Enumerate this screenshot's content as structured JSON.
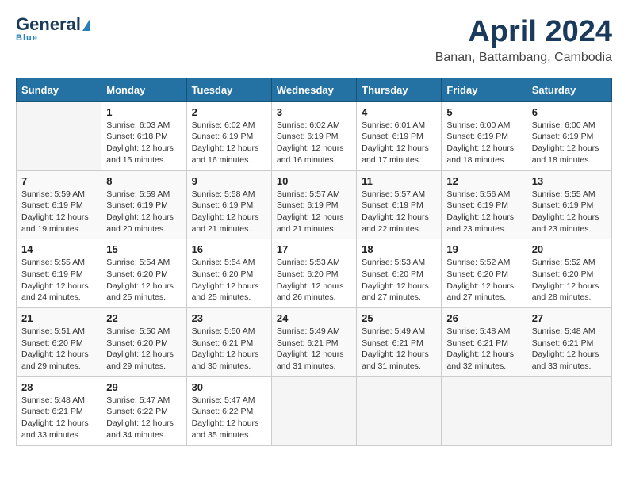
{
  "logo": {
    "general": "General",
    "blue": "Blue",
    "tagline": "Blue"
  },
  "header": {
    "month": "April 2024",
    "location": "Banan, Battambang, Cambodia"
  },
  "weekdays": [
    "Sunday",
    "Monday",
    "Tuesday",
    "Wednesday",
    "Thursday",
    "Friday",
    "Saturday"
  ],
  "weeks": [
    [
      {
        "day": "",
        "sunrise": "",
        "sunset": "",
        "daylight": ""
      },
      {
        "day": "1",
        "sunrise": "Sunrise: 6:03 AM",
        "sunset": "Sunset: 6:18 PM",
        "daylight": "Daylight: 12 hours and 15 minutes."
      },
      {
        "day": "2",
        "sunrise": "Sunrise: 6:02 AM",
        "sunset": "Sunset: 6:19 PM",
        "daylight": "Daylight: 12 hours and 16 minutes."
      },
      {
        "day": "3",
        "sunrise": "Sunrise: 6:02 AM",
        "sunset": "Sunset: 6:19 PM",
        "daylight": "Daylight: 12 hours and 16 minutes."
      },
      {
        "day": "4",
        "sunrise": "Sunrise: 6:01 AM",
        "sunset": "Sunset: 6:19 PM",
        "daylight": "Daylight: 12 hours and 17 minutes."
      },
      {
        "day": "5",
        "sunrise": "Sunrise: 6:00 AM",
        "sunset": "Sunset: 6:19 PM",
        "daylight": "Daylight: 12 hours and 18 minutes."
      },
      {
        "day": "6",
        "sunrise": "Sunrise: 6:00 AM",
        "sunset": "Sunset: 6:19 PM",
        "daylight": "Daylight: 12 hours and 18 minutes."
      }
    ],
    [
      {
        "day": "7",
        "sunrise": "Sunrise: 5:59 AM",
        "sunset": "Sunset: 6:19 PM",
        "daylight": "Daylight: 12 hours and 19 minutes."
      },
      {
        "day": "8",
        "sunrise": "Sunrise: 5:59 AM",
        "sunset": "Sunset: 6:19 PM",
        "daylight": "Daylight: 12 hours and 20 minutes."
      },
      {
        "day": "9",
        "sunrise": "Sunrise: 5:58 AM",
        "sunset": "Sunset: 6:19 PM",
        "daylight": "Daylight: 12 hours and 21 minutes."
      },
      {
        "day": "10",
        "sunrise": "Sunrise: 5:57 AM",
        "sunset": "Sunset: 6:19 PM",
        "daylight": "Daylight: 12 hours and 21 minutes."
      },
      {
        "day": "11",
        "sunrise": "Sunrise: 5:57 AM",
        "sunset": "Sunset: 6:19 PM",
        "daylight": "Daylight: 12 hours and 22 minutes."
      },
      {
        "day": "12",
        "sunrise": "Sunrise: 5:56 AM",
        "sunset": "Sunset: 6:19 PM",
        "daylight": "Daylight: 12 hours and 23 minutes."
      },
      {
        "day": "13",
        "sunrise": "Sunrise: 5:55 AM",
        "sunset": "Sunset: 6:19 PM",
        "daylight": "Daylight: 12 hours and 23 minutes."
      }
    ],
    [
      {
        "day": "14",
        "sunrise": "Sunrise: 5:55 AM",
        "sunset": "Sunset: 6:19 PM",
        "daylight": "Daylight: 12 hours and 24 minutes."
      },
      {
        "day": "15",
        "sunrise": "Sunrise: 5:54 AM",
        "sunset": "Sunset: 6:20 PM",
        "daylight": "Daylight: 12 hours and 25 minutes."
      },
      {
        "day": "16",
        "sunrise": "Sunrise: 5:54 AM",
        "sunset": "Sunset: 6:20 PM",
        "daylight": "Daylight: 12 hours and 25 minutes."
      },
      {
        "day": "17",
        "sunrise": "Sunrise: 5:53 AM",
        "sunset": "Sunset: 6:20 PM",
        "daylight": "Daylight: 12 hours and 26 minutes."
      },
      {
        "day": "18",
        "sunrise": "Sunrise: 5:53 AM",
        "sunset": "Sunset: 6:20 PM",
        "daylight": "Daylight: 12 hours and 27 minutes."
      },
      {
        "day": "19",
        "sunrise": "Sunrise: 5:52 AM",
        "sunset": "Sunset: 6:20 PM",
        "daylight": "Daylight: 12 hours and 27 minutes."
      },
      {
        "day": "20",
        "sunrise": "Sunrise: 5:52 AM",
        "sunset": "Sunset: 6:20 PM",
        "daylight": "Daylight: 12 hours and 28 minutes."
      }
    ],
    [
      {
        "day": "21",
        "sunrise": "Sunrise: 5:51 AM",
        "sunset": "Sunset: 6:20 PM",
        "daylight": "Daylight: 12 hours and 29 minutes."
      },
      {
        "day": "22",
        "sunrise": "Sunrise: 5:50 AM",
        "sunset": "Sunset: 6:20 PM",
        "daylight": "Daylight: 12 hours and 29 minutes."
      },
      {
        "day": "23",
        "sunrise": "Sunrise: 5:50 AM",
        "sunset": "Sunset: 6:21 PM",
        "daylight": "Daylight: 12 hours and 30 minutes."
      },
      {
        "day": "24",
        "sunrise": "Sunrise: 5:49 AM",
        "sunset": "Sunset: 6:21 PM",
        "daylight": "Daylight: 12 hours and 31 minutes."
      },
      {
        "day": "25",
        "sunrise": "Sunrise: 5:49 AM",
        "sunset": "Sunset: 6:21 PM",
        "daylight": "Daylight: 12 hours and 31 minutes."
      },
      {
        "day": "26",
        "sunrise": "Sunrise: 5:48 AM",
        "sunset": "Sunset: 6:21 PM",
        "daylight": "Daylight: 12 hours and 32 minutes."
      },
      {
        "day": "27",
        "sunrise": "Sunrise: 5:48 AM",
        "sunset": "Sunset: 6:21 PM",
        "daylight": "Daylight: 12 hours and 33 minutes."
      }
    ],
    [
      {
        "day": "28",
        "sunrise": "Sunrise: 5:48 AM",
        "sunset": "Sunset: 6:21 PM",
        "daylight": "Daylight: 12 hours and 33 minutes."
      },
      {
        "day": "29",
        "sunrise": "Sunrise: 5:47 AM",
        "sunset": "Sunset: 6:22 PM",
        "daylight": "Daylight: 12 hours and 34 minutes."
      },
      {
        "day": "30",
        "sunrise": "Sunrise: 5:47 AM",
        "sunset": "Sunset: 6:22 PM",
        "daylight": "Daylight: 12 hours and 35 minutes."
      },
      {
        "day": "",
        "sunrise": "",
        "sunset": "",
        "daylight": ""
      },
      {
        "day": "",
        "sunrise": "",
        "sunset": "",
        "daylight": ""
      },
      {
        "day": "",
        "sunrise": "",
        "sunset": "",
        "daylight": ""
      },
      {
        "day": "",
        "sunrise": "",
        "sunset": "",
        "daylight": ""
      }
    ]
  ]
}
